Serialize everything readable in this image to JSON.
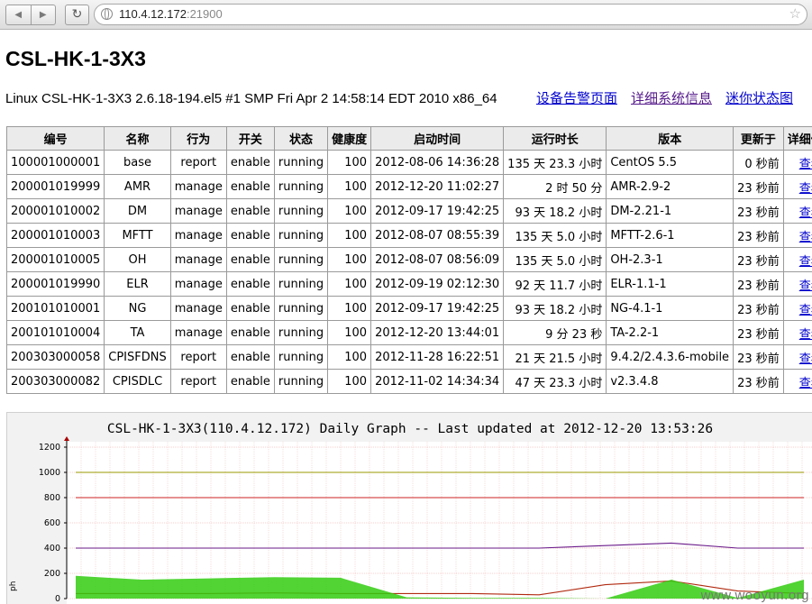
{
  "browser": {
    "back_icon": "◀",
    "forward_icon": "▶",
    "reload_icon": "↻",
    "url_host": "110.4.12.172",
    "url_port": ":21900",
    "star_icon": "☆"
  },
  "page": {
    "title": "CSL-HK-1-3X3",
    "sysinfo": "Linux CSL-HK-1-3X3 2.6.18-194.el5 #1 SMP Fri Apr 2 14:58:14 EDT 2010 x86_64",
    "links": [
      "设备告警页面",
      "详细系统信息",
      "迷你状态图"
    ]
  },
  "table": {
    "headers": [
      "编号",
      "名称",
      "行为",
      "开关",
      "状态",
      "健康度",
      "启动时间",
      "运行时长",
      "版本",
      "更新于",
      "详细信息"
    ],
    "rows": [
      [
        "100001000001",
        "base",
        "report",
        "enable",
        "running",
        "100",
        "2012-08-06 14:36:28",
        "135 天 23.3 小时",
        "CentOS 5.5",
        "0 秒前",
        "查看"
      ],
      [
        "200001019999",
        "AMR",
        "manage",
        "enable",
        "running",
        "100",
        "2012-12-20 11:02:27",
        "2 时 50 分",
        "AMR-2.9-2",
        "23 秒前",
        "查看"
      ],
      [
        "200001010002",
        "DM",
        "manage",
        "enable",
        "running",
        "100",
        "2012-09-17 19:42:25",
        "93 天 18.2 小时",
        "DM-2.21-1",
        "23 秒前",
        "查看"
      ],
      [
        "200001010003",
        "MFTT",
        "manage",
        "enable",
        "running",
        "100",
        "2012-08-07 08:55:39",
        "135 天 5.0 小时",
        "MFTT-2.6-1",
        "23 秒前",
        "查看"
      ],
      [
        "200001010005",
        "OH",
        "manage",
        "enable",
        "running",
        "100",
        "2012-08-07 08:56:09",
        "135 天 5.0 小时",
        "OH-2.3-1",
        "23 秒前",
        "查看"
      ],
      [
        "200001019990",
        "ELR",
        "manage",
        "enable",
        "running",
        "100",
        "2012-09-19 02:12:30",
        "92 天 11.7 小时",
        "ELR-1.1-1",
        "23 秒前",
        "查看"
      ],
      [
        "200101010001",
        "NG",
        "manage",
        "enable",
        "running",
        "100",
        "2012-09-17 19:42:25",
        "93 天 18.2 小时",
        "NG-4.1-1",
        "23 秒前",
        "查看"
      ],
      [
        "200101010004",
        "TA",
        "manage",
        "enable",
        "running",
        "100",
        "2012-12-20 13:44:01",
        "9 分 23 秒",
        "TA-2.2-1",
        "23 秒前",
        "查看"
      ],
      [
        "200303000058",
        "CPISFDNS",
        "report",
        "enable",
        "running",
        "100",
        "2012-11-28 16:22:51",
        "21 天 21.5 小时",
        "9.4.2/2.4.3.6-mobile",
        "23 秒前",
        "查看"
      ],
      [
        "200303000082",
        "CPISDLC",
        "report",
        "enable",
        "running",
        "100",
        "2012-11-02 14:34:34",
        "47 天 23.3 小时",
        "v2.3.4.8",
        "23 秒前",
        "查看"
      ]
    ]
  },
  "graph": {
    "title": "CSL-HK-1-3X3(110.4.12.172) Daily Graph -- Last updated at 2012-12-20 13:53:26",
    "ylabel_fragment": "ph",
    "watermark": "www.wooyun.org"
  },
  "chart_data": {
    "type": "line",
    "title": "CSL-HK-1-3X3(110.4.12.172) Daily Graph -- Last updated at 2012-12-20 13:53:26",
    "ylabel": "ph",
    "ylim": [
      0,
      1200
    ],
    "yticks": [
      "0",
      "200",
      "400",
      "600",
      "800",
      "1000",
      "1200"
    ],
    "grid": true,
    "series": [
      {
        "color": "#9a9a00",
        "values": [
          1000,
          1000,
          1000,
          1000,
          1000,
          1000,
          1000,
          1000,
          1000,
          1000,
          1000,
          1000
        ]
      },
      {
        "color": "#cc2222",
        "values": [
          800,
          800,
          800,
          800,
          800,
          800,
          800,
          800,
          800,
          800,
          800,
          800
        ]
      },
      {
        "color": "#6a1a8a",
        "values": [
          400,
          400,
          400,
          400,
          400,
          400,
          400,
          400,
          420,
          440,
          400,
          400
        ]
      },
      {
        "color": "#b02a10",
        "values": [
          40,
          40,
          40,
          45,
          40,
          40,
          40,
          30,
          110,
          140,
          60,
          40
        ]
      },
      {
        "color": "#33cc11",
        "values": [
          180,
          150,
          160,
          170,
          165,
          10,
          5,
          5,
          0,
          150,
          5,
          150
        ]
      }
    ]
  }
}
